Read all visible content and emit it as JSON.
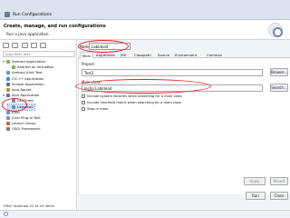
{
  "window": {
    "title": "Run Configurations",
    "header_title": "Create, manage, and run configurations",
    "header_subtitle": "Run a Java application"
  },
  "left": {
    "filter_placeholder": "type filter text",
    "tree": [
      {
        "label": "Android Application",
        "level": 0,
        "expanded": true,
        "icon_color": "#7fb34b"
      },
      {
        "label": "Android ex VirtuaBox",
        "level": 1,
        "icon_color": "#7fb34b"
      },
      {
        "label": "Android JUnit Test",
        "level": 0,
        "icon_color": "#6c8fd6"
      },
      {
        "label": "C/C++ Application",
        "level": 0,
        "icon_color": "#5b7ec7"
      },
      {
        "label": "Eclipse Application",
        "level": 0,
        "icon_color": "#4f6fa8"
      },
      {
        "label": "Java Applet",
        "level": 0,
        "icon_color": "#c58a39"
      },
      {
        "label": "Java Application",
        "level": 0,
        "expanded": true,
        "icon_color": "#5a6fa8"
      },
      {
        "label": "LabThree",
        "level": 1,
        "icon_color": "#8a7eb0"
      },
      {
        "label": "LabIdea4",
        "level": 1,
        "icon_color": "#8a7eb0",
        "selected": true
      },
      {
        "label": "JUnit",
        "level": 0,
        "icon_color": "#6c8fd6"
      },
      {
        "label": "JUnit Plug-in Test",
        "level": 0,
        "icon_color": "#6c8fd6"
      },
      {
        "label": "Launch Group",
        "level": 0,
        "icon_color": "#b96f2f"
      },
      {
        "label": "OSGi Framework",
        "level": 0,
        "icon_color": "#7b7b7b"
      }
    ],
    "filter_status": "Filter matched 22 of 44 items"
  },
  "right": {
    "name_label": "Name:",
    "name_value": "LabIdea4",
    "tabs": [
      "Main",
      "Arguments",
      "JRE",
      "Classpath",
      "Source",
      "Environment",
      "Common"
    ],
    "project_label": "Project:",
    "project_value": "Test2",
    "project_browse": "Browse...",
    "main_class_label": "Main class:",
    "main_class_value": "lecho.LabIdea4",
    "main_class_search": "Search...",
    "checkboxes": [
      "Include system libraries when searching for a main class",
      "Include inherited mains when searching for a main class",
      "Stop in main"
    ],
    "apply": "Apply",
    "revert": "Revert"
  },
  "footer": {
    "run": "Run",
    "close": "Close"
  },
  "colors": {
    "highlight": "#e52020",
    "selection": "#cfe2ff"
  }
}
